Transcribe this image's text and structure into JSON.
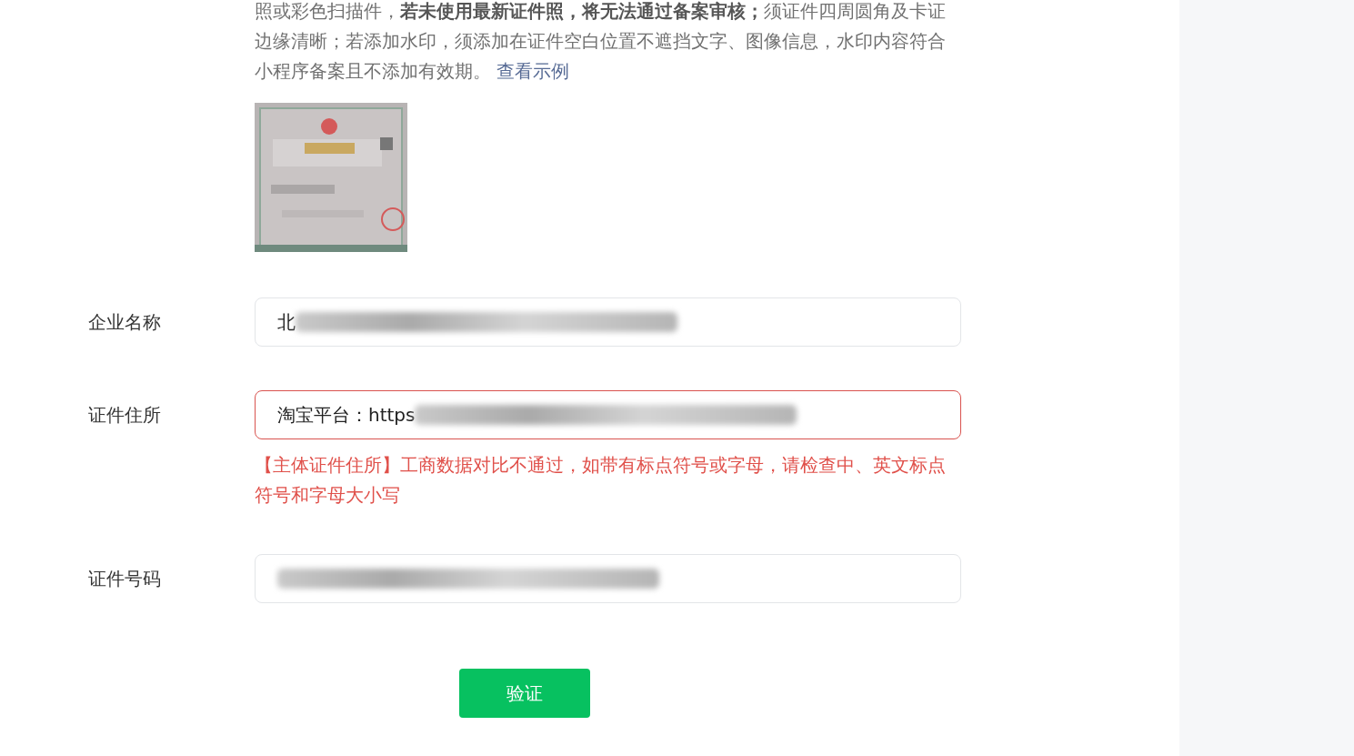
{
  "notice": {
    "text": "照或彩色扫描件，**若未使用最新证件照，将无法通过备案审核；**须证件四周圆角及卡证边缘清晰；若添加水印，须添加在证件空白位置不遮挡文字、图像信息，水印内容符合小程序备案且不添加有效期。",
    "link": "查看示例"
  },
  "fields": [
    {
      "label": "企业名称",
      "value": "北",
      "redacted": true,
      "error": false
    },
    {
      "label": "证件住所",
      "value": "淘宝平台：https",
      "redacted": true,
      "error": true,
      "error_text": "【主体证件住所】工商数据对比不通过，如带有标点符号或字母，请检查中、英文标点符号和字母大小写"
    },
    {
      "label": "证件号码",
      "redacted": true,
      "error": false
    }
  ],
  "submit_button": "验证"
}
